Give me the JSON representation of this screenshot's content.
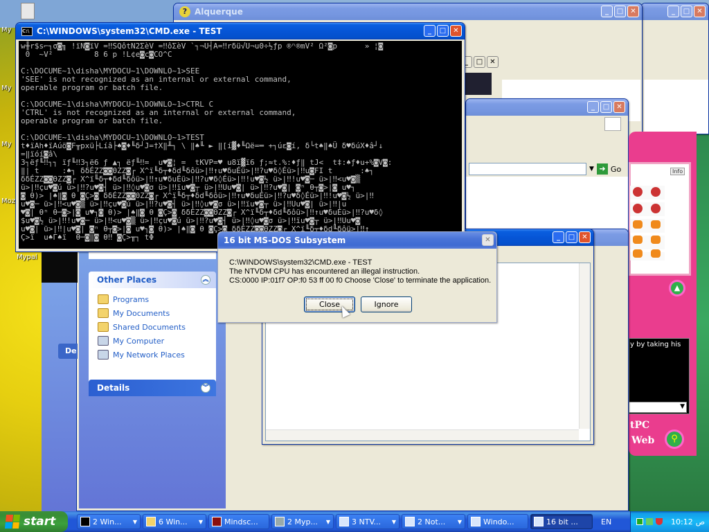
{
  "desktop": {
    "icons": [
      "My",
      "My",
      "My",
      "Mozi",
      "Mypal"
    ]
  },
  "windows": {
    "alquerque": {
      "title": "Alquerque"
    },
    "cmd": {
      "title": "C:\\WINDOWS\\system32\\CMD.exe - TEST",
      "lines": [
        "w╫r$s⌐┐σ◙╗ !ïN◙ïV =‼SQôtN2ΣèV =‼ôΣèV `┐¬U┤A=‼rδü√U¬u0÷½ƒp ®ⁿ®mV² Ω²◙p      » ¦◙",
        " 0  ~V²         8 6 p !L¢e◙c◙CO^C",
        "",
        "C:\\DOCUME~1\\disha\\MYDOCU~1\\DOWNLO~1>SEE",
        "'SEE' is not recognized as an internal or external command,",
        "operable program or batch file.",
        "",
        "C:\\DOCUME~1\\disha\\MYDOCU~1\\DOWNLO~1>CTRL C",
        "'CTRL' is not recognized as an internal or external command,",
        "operable program or batch file.",
        "",
        "C:\\DOCUME~1\\disha\\MYDOCU~1\\DOWNLO~1>TEST",
        "t♦ïAh♦ïAúö◙F╥pxü├Líâ├♠◙♦╙δ┘J=†X‖╨┐ \\ ‖♠╙ ► ‖[í▓♦╙Ωë=═ +┐úε◙í, δ└t♠‖♠Ü δ♥δúX♦â┘↓",
        "=‖ïóí◙â\\",
        "3┐ëƒ╙‼┐┐ ïƒ╙‼3┐ë6 ƒ ▲┐ ëƒ╙‼=  u♥◙¦ =  tKVP=♥ u8ï▓ï6 ƒ;≈t.%:♦ƒ‖ tJ<  t‡:♠ƒ♦u+%◙V◙:",
        "‖| t     :♠┐ δδÉZZ◙◙ΘZZ◙┌ X^ï╙δ┬♦δd╙δôü>|‼↑u♥δuÉü>|‼?u♥δ◊Éü>|‼u◙FI t      :♠┐",
        "δδÉZZ◙◙ΘZZ◙┌ X^ï╙δ┬♦δd╙δôü>|‼↑u♥δuÉü>|‼?u♥δ◊Éü>|‼!u♥◙½ ü>|‼!u♥◙─ ü>|‼<u♥◙▒",
        "ü>|‼çu♥◙ú ü>|‼?u♥◙┤ ü>|‼◊u♥◙σ ü>|‼ïu♥◙┬ ü>|‼Uu♥◙| ü>|‼?u♥◙| ◙ⁿ θ┬◙>|◙ u♥┐",
        "◙ θ)> |♠‖◙ θ ◙Ç>◙ δδÉZZ◙◙ΘZZ◙┌ X^ï╙δ┬♦δd╙δôü>|‼↑u♥δuÉü>|‼?u♥δ◊Éü>|‼!u♥◙½ ü>|‼",
        "u♥◙─ ü>|‼<u♥◙▒ ü>|‼çu♥◙ú ü>|‼?u♥◙┤ ü>|‼◊u♥◙σ ü>|‼ïu♥◙┬ ü>|‼Uu♥◙| ü>|‼|u",
        "♥◙| θⁿ θ─◙>|◙ u♥┐◙ θ)> |♠‖◙ θ ◙Ç>◙ δδÉZZ◙◙ΘZZ◙┌ X^ï╙δ┬♦δd╙δôü>|‼↑u♥δuÉü>|‼?u♥δ◊",
        "$u♥◙½ ü>|‼!u♥◙─ ü>|‼<u♥◙▒ ü>|‼çu♥◙ú ü>|‼?u♥◙┤ ü>|‼◊u♥◙σ ü>|‼ïu♥◙┬ ü>|‼Uu♥◙",
        "u♥◙| ü>|‼|u♥◙| ◙ⁿ θ┬◙>|◙ u♥┐◙ θ)> |♠‖◙ θ ◙Ç>◙ δδÉZZ◙◙ΘZZ◙┌ X^ï╙δ┬♦δd╙δôü>|‼↑",
        "Ç>ï  u♠Γ♠ï  θ─◙‖◙ θ‼ ◙Ç>╥┐ tΦ"
      ]
    },
    "explorer_back": {
      "address_go": "Go"
    },
    "explorer_main": {
      "other_places_header": "Other Places",
      "other_places": [
        "Programs",
        "My Documents",
        "Shared Documents",
        "My Computer",
        "My Network Places"
      ],
      "details_header": "Details",
      "partial_button": "De"
    },
    "mypal": {
      "tab_label": "Info",
      "caption": "y by taking his",
      "footer_line1": "tPC",
      "footer_line2": "Web"
    },
    "dialog": {
      "title": "16 bit MS-DOS Subsystem",
      "line1": "C:\\WINDOWS\\system32\\CMD.exe - TEST",
      "line2": "The NTVDM CPU has encountered an illegal instruction.",
      "line3": "CS:0000 IP:01f7 OP:f0 53 ff 00 f0 Choose 'Close' to terminate the application.",
      "close_label": "Close",
      "ignore_label": "Ignore"
    }
  },
  "taskbar": {
    "start_label": "start",
    "items": [
      {
        "label": "2 Win...",
        "active": false
      },
      {
        "label": "6 Win...",
        "active": false
      },
      {
        "label": "Mindsc...",
        "active": false
      },
      {
        "label": "2 Myp...",
        "active": false
      },
      {
        "label": "3 NTV...",
        "active": false
      },
      {
        "label": "2 Not...",
        "active": false
      },
      {
        "label": "Windo...",
        "active": false
      },
      {
        "label": "16 bit ...",
        "active": true
      }
    ],
    "language": "EN",
    "time": "10:12",
    "time_suffix": "ص"
  }
}
